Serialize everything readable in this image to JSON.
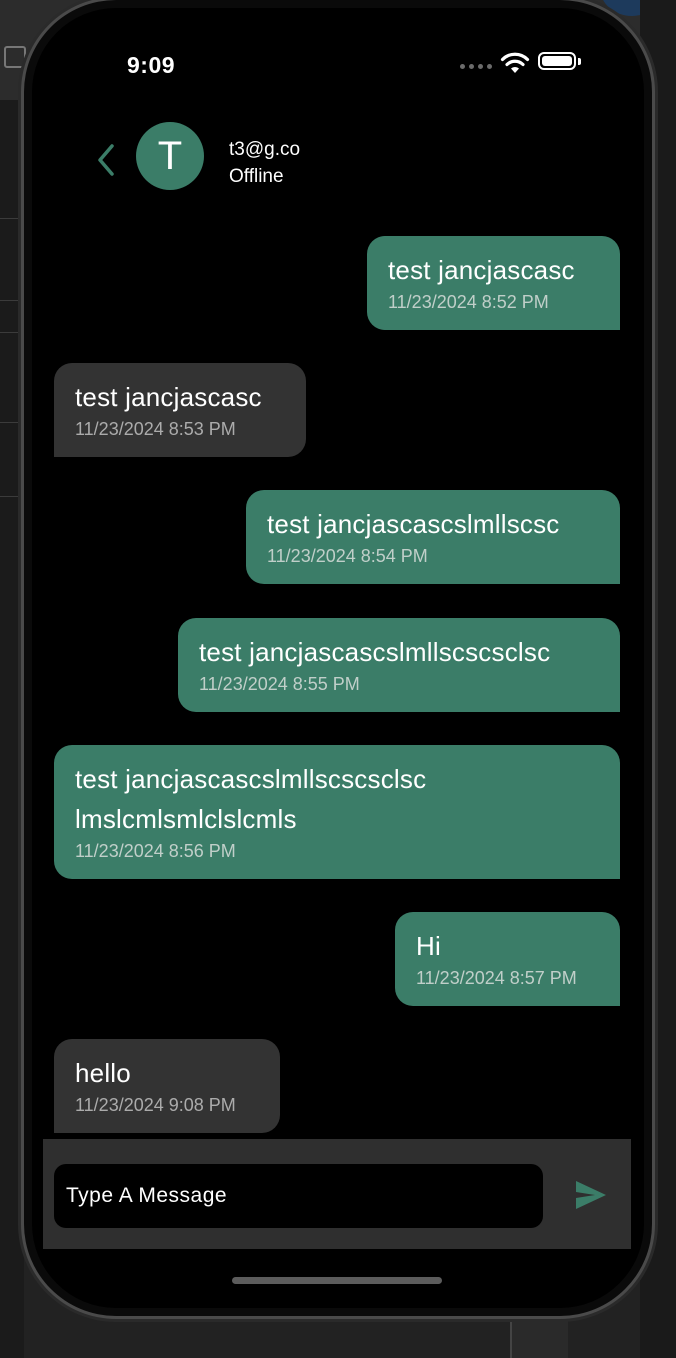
{
  "status_bar": {
    "time": "9:09"
  },
  "header": {
    "avatar_initial": "T",
    "contact_name": "t3@g.co",
    "contact_status": "Offline"
  },
  "messages": [
    {
      "direction": "sent",
      "text": "test jancjascasc",
      "time": "11/23/2024 8:52 PM"
    },
    {
      "direction": "received",
      "text": "test jancjascasc",
      "time": "11/23/2024 8:53 PM"
    },
    {
      "direction": "sent",
      "text": "test jancjascascslmllscsc",
      "time": "11/23/2024 8:54 PM"
    },
    {
      "direction": "sent",
      "text": "test jancjascascslmllscscsclsc",
      "time": "11/23/2024 8:55 PM"
    },
    {
      "direction": "sent",
      "text": "test jancjascascslmllscscsclsc lmslcmlsmlclslcmls",
      "time": "11/23/2024 8:56 PM"
    },
    {
      "direction": "sent",
      "text": "Hi",
      "time": "11/23/2024 8:57 PM"
    },
    {
      "direction": "received",
      "text": "hello",
      "time": "11/23/2024 9:08 PM"
    }
  ],
  "composer": {
    "placeholder": "Type A Message"
  },
  "colors": {
    "sent_bubble": "#3b7d68",
    "received_bubble": "#333333",
    "accent": "#3b7d68",
    "background": "#000000",
    "input_bar": "#2f2f2f"
  }
}
